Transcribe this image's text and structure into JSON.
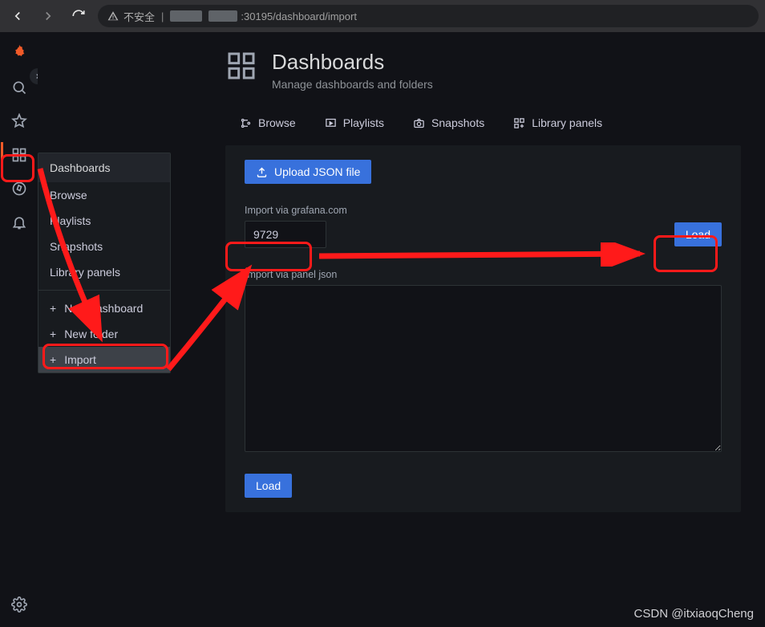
{
  "browser": {
    "insecure_label": "不安全",
    "url_suffix": ":30195/dashboard/import"
  },
  "page": {
    "title": "Dashboards",
    "subtitle": "Manage dashboards and folders"
  },
  "tabs": {
    "browse": "Browse",
    "playlists": "Playlists",
    "snapshots": "Snapshots",
    "library": "Library panels"
  },
  "flyout": {
    "header": "Dashboards",
    "browse": "Browse",
    "playlists": "Playlists",
    "snapshots": "Snapshots",
    "library": "Library panels",
    "new_dashboard": "New dashboard",
    "new_folder": "New folder",
    "import": "Import"
  },
  "panel": {
    "upload_btn": "Upload JSON file",
    "import_via_label": "Import via grafana.com",
    "import_via_value": "9729",
    "load_btn": "Load",
    "panel_json_label": "Import via panel json",
    "panel_json_value": "",
    "load_btn2": "Load"
  },
  "watermark": "CSDN @itxiaoqCheng"
}
